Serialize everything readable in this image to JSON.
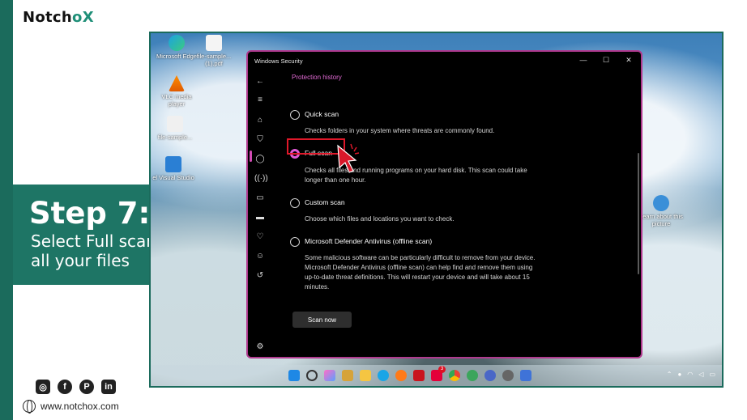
{
  "brand": {
    "logo_text_a": "Notch",
    "logo_text_b": "o",
    "logo_text_c": "X",
    "accent_color": "#1f8f78",
    "bar_color": "#1b6b5c"
  },
  "step": {
    "title": "Step 7:",
    "description": "Select Full scan to check all your files"
  },
  "footer": {
    "website": "www.notchox.com",
    "social": [
      "instagram-icon",
      "facebook-icon",
      "pinterest-icon",
      "linkedin-icon"
    ]
  },
  "desktop": {
    "icons": [
      {
        "label": "Microsoft Edge"
      },
      {
        "label": "file-sample... (1).pdf"
      },
      {
        "label": "VLC media player"
      },
      {
        "label": "file-sample..."
      },
      {
        "label": "el Visual Studio"
      },
      {
        "label": "Learn about this picture"
      }
    ]
  },
  "window": {
    "title": "Windows Security",
    "controls": [
      "—",
      "☐",
      "✕"
    ],
    "breadcrumb": "Protection history",
    "options": [
      {
        "label": "Quick scan",
        "desc": "Checks folders in your system where threats are commonly found.",
        "selected": false
      },
      {
        "label": "Full scan",
        "desc": "Checks all files and running programs on your hard disk. This scan could take longer than one hour.",
        "selected": true
      },
      {
        "label": "Custom scan",
        "desc": "Choose which files and locations you want to check.",
        "selected": false
      },
      {
        "label": "Microsoft Defender Antivirus (offline scan)",
        "desc": "Some malicious software can be particularly difficult to remove from your device. Microsoft Defender Antivirus (offline scan) can help find and remove them using up-to-date threat definitions. This will restart your device and will take about 15 minutes.",
        "selected": false
      }
    ],
    "scan_button": "Scan now"
  },
  "taskbar": {
    "badge_count": "3"
  }
}
